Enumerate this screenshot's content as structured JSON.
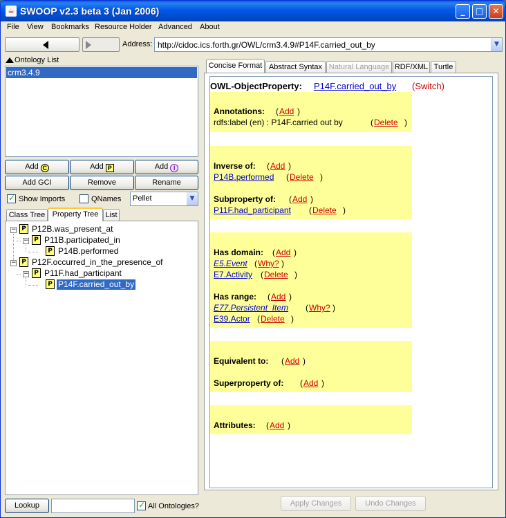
{
  "window": {
    "title": "SWOOP v2.3 beta 3 (Jan 2006)",
    "icon": "java-cup-icon"
  },
  "menu": [
    "File",
    "View",
    "Bookmarks",
    "Resource Holder",
    "Advanced",
    "About"
  ],
  "address": {
    "label": "Address:",
    "value": "http://cidoc.ics.forth.gr/OWL/crm3.4.9#P14F.carried_out_by"
  },
  "ontology_list": {
    "header": "Ontology List",
    "items": [
      "crm3.4.9"
    ]
  },
  "buttons": {
    "add_class": "Add",
    "add_property": "Add",
    "add_individual": "Add",
    "add_gci": "Add GCI",
    "remove": "Remove",
    "rename": "Rename",
    "lookup": "Lookup",
    "apply_changes": "Apply Changes",
    "undo_changes": "Undo Changes"
  },
  "badges": {
    "class": "C",
    "property": "P",
    "individual": "I"
  },
  "options": {
    "show_imports": "Show Imports",
    "qnames": "QNames",
    "reasoner": "Pellet",
    "all_ontologies": "All Ontologies?"
  },
  "left_tabs": [
    "Class Tree",
    "Property Tree",
    "List"
  ],
  "tree": [
    {
      "label": "P12B.was_present_at",
      "badge": "P"
    },
    {
      "label": "P11B.participated_in",
      "badge": "P"
    },
    {
      "label": "P14B.performed",
      "badge": "P"
    },
    {
      "label": "P12F.occurred_in_the_presence_of",
      "badge": "P"
    },
    {
      "label": "P11F.had_participant",
      "badge": "P"
    },
    {
      "label": "P14F.carried_out_by",
      "badge": "P"
    }
  ],
  "right_tabs": [
    "Concise Format",
    "Abstract Syntax",
    "Natural Language",
    "RDF/XML",
    "Turtle"
  ],
  "entity": {
    "kind": "OWL-ObjectProperty:",
    "name": "P14F.carried_out_by",
    "switch": "(Switch)",
    "annotations_label": "Annotations:",
    "annotation_value": "rdfs:label (en) : P14F.carried out by",
    "inverse_label": "Inverse of:",
    "inverse_value": "P14B.performed",
    "subprop_label": "Subproperty of:",
    "subprop_value": "P11F.had_participant",
    "domain_label": "Has domain:",
    "domain_values": [
      "E5.Event",
      "E7.Activity"
    ],
    "range_label": "Has range:",
    "range_values": [
      "E77.Persistent_Item",
      "E39.Actor"
    ],
    "equivalent_label": "Equivalent to:",
    "superprop_label": "Superproperty of:",
    "attributes_label": "Attributes:",
    "add": "Add",
    "delete": "Delete",
    "why": "Why?"
  }
}
